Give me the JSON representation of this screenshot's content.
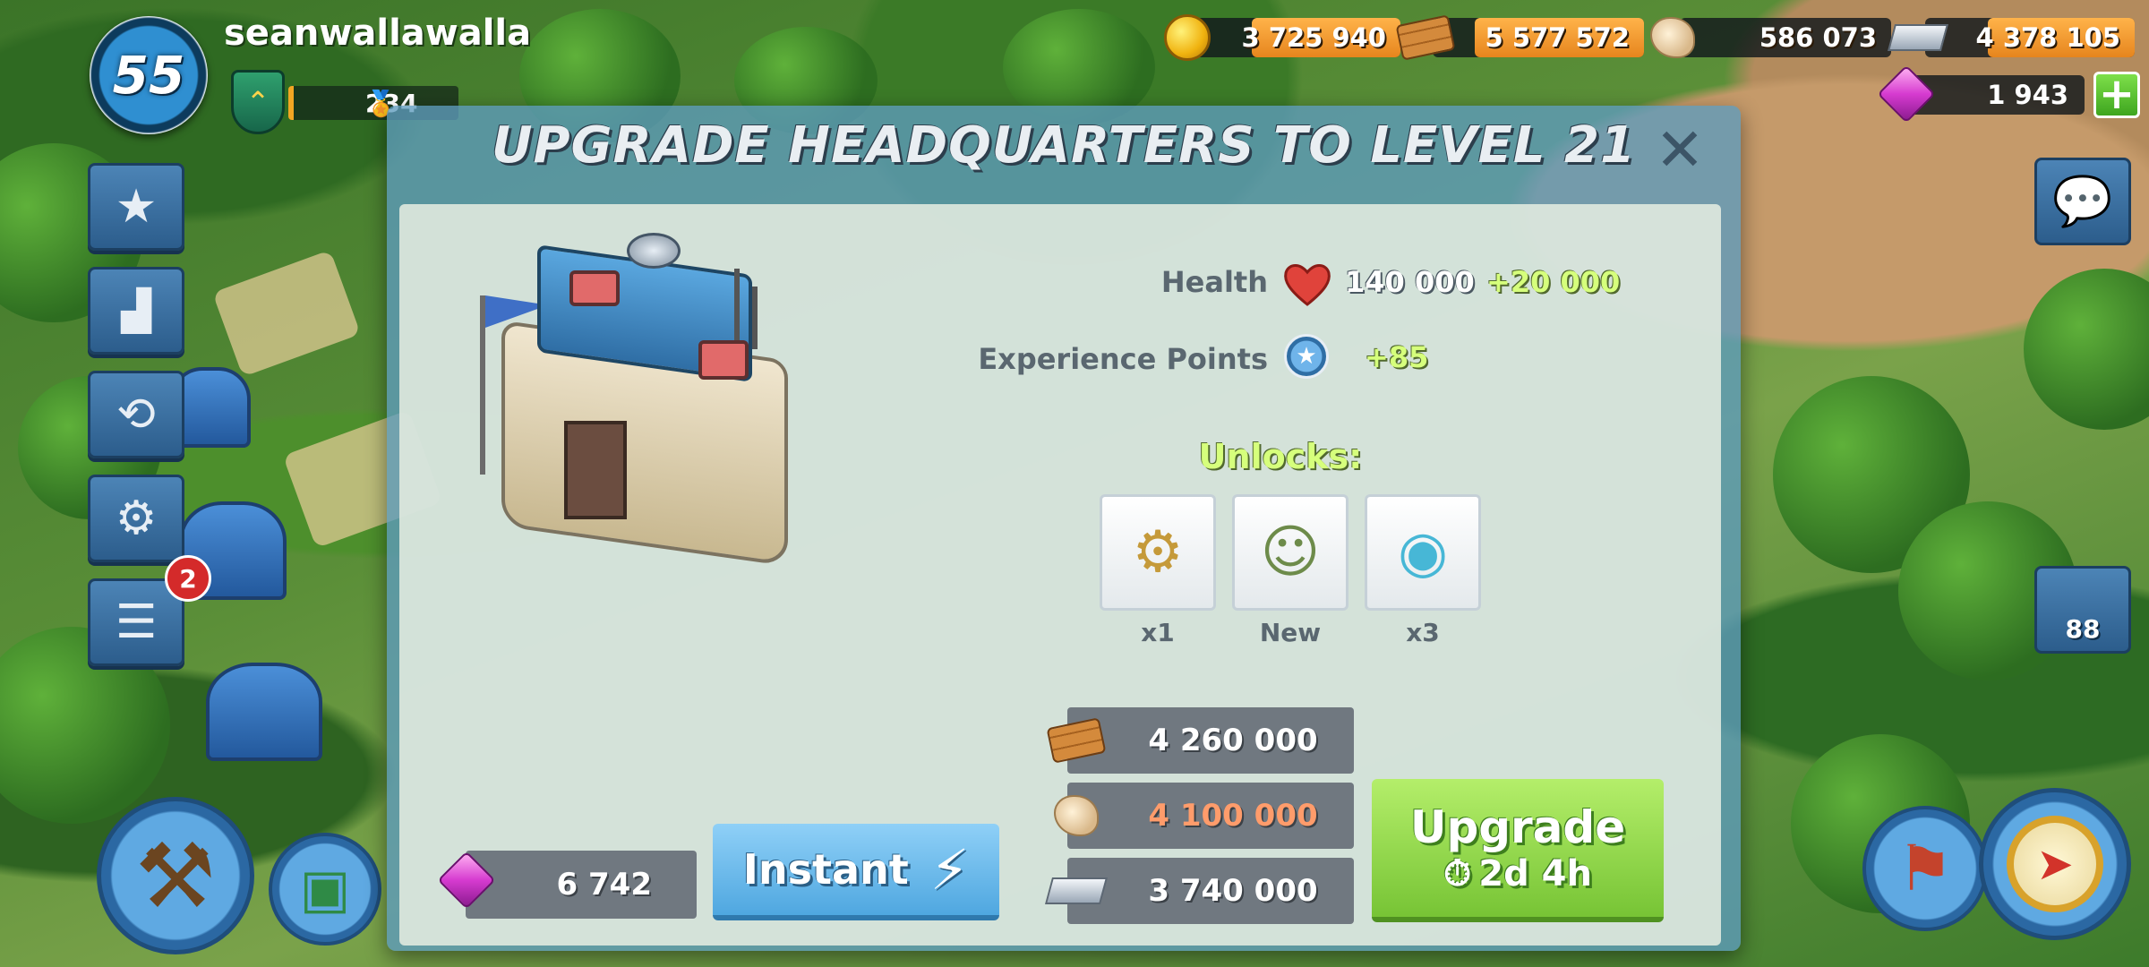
{
  "player": {
    "level": "55",
    "name": "seanwallawalla",
    "medals": "234"
  },
  "resources": {
    "gold": "3 725 940",
    "wood": "5 577 572",
    "stone": "586 073",
    "iron": "4 378 105",
    "diamonds": "1 943",
    "add_label": "+"
  },
  "sidebar": {
    "notification_count": "2",
    "troops_count": "88"
  },
  "dialog": {
    "title": "UPGRADE HEADQUARTERS TO LEVEL 21",
    "close_label": "✕",
    "stats": {
      "health_label": "Health",
      "health_value": "140 000",
      "health_bonus": "+20 000",
      "xp_label": "Experience Points",
      "xp_bonus": "+85"
    },
    "unlocks": {
      "title": "Unlocks:",
      "items": [
        {
          "label": "x1",
          "icon": "cannon-icon"
        },
        {
          "label": "New",
          "icon": "hero-portrait-icon"
        },
        {
          "label": "x3",
          "icon": "prototype-module-icon"
        }
      ]
    },
    "costs": {
      "wood": "4 260 000",
      "stone": "4 100 000",
      "iron": "3 740 000"
    },
    "instant": {
      "gem_cost": "6 742",
      "label": "Instant"
    },
    "upgrade": {
      "label": "Upgrade",
      "time": "2d 4h"
    }
  },
  "colors": {
    "accent_green": "#d6ff7c",
    "short_resource": "#ff9c6b",
    "button_blue": "#4fa7e0",
    "button_green": "#77c435"
  }
}
